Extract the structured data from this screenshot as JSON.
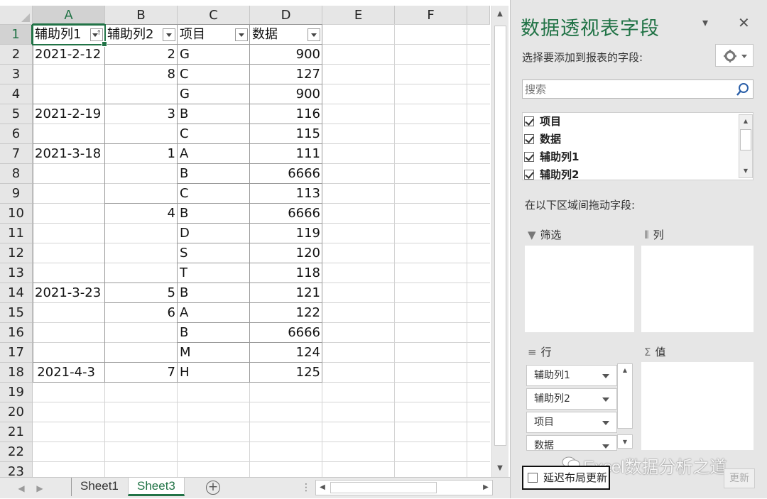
{
  "sheet": {
    "columns": [
      "A",
      "B",
      "C",
      "D",
      "E",
      "F"
    ],
    "rows": [
      "1",
      "2",
      "3",
      "4",
      "5",
      "6",
      "7",
      "8",
      "9",
      "10",
      "11",
      "12",
      "13",
      "14",
      "15",
      "16",
      "17",
      "18",
      "19",
      "20",
      "21",
      "22",
      "23"
    ],
    "headers": [
      "辅助列1",
      "辅助列2",
      "项目",
      "数据"
    ],
    "data": [
      [
        "2021-2-12",
        "2",
        "G",
        "900"
      ],
      [
        "",
        "8",
        "C",
        "127"
      ],
      [
        "",
        "",
        "G",
        "900"
      ],
      [
        "2021-2-19",
        "3",
        "B",
        "116"
      ],
      [
        "",
        "",
        "C",
        "115"
      ],
      [
        "2021-3-18",
        "1",
        "A",
        "111"
      ],
      [
        "",
        "",
        "B",
        "6666"
      ],
      [
        "",
        "",
        "C",
        "113"
      ],
      [
        "",
        "4",
        "B",
        "6666"
      ],
      [
        "",
        "",
        "D",
        "119"
      ],
      [
        "",
        "",
        "S",
        "120"
      ],
      [
        "",
        "",
        "T",
        "118"
      ],
      [
        "2021-3-23",
        "5",
        "B",
        "121"
      ],
      [
        "",
        "6",
        "A",
        "122"
      ],
      [
        "",
        "",
        "B",
        "6666"
      ],
      [
        "",
        "",
        "M",
        "124"
      ],
      [
        "2021-4-3",
        "7",
        "H",
        "125"
      ]
    ],
    "tabs": [
      "Sheet1",
      "Sheet3"
    ],
    "active_tab": "Sheet3"
  },
  "pane": {
    "title": "数据透视表字段",
    "choose_label": "选择要添加到报表的字段:",
    "search_placeholder": "搜索",
    "fields": [
      "项目",
      "数据",
      "辅助列1",
      "辅助列2"
    ],
    "drag_label": "在以下区域间拖动字段:",
    "areas": {
      "filter": "筛选",
      "columns": "列",
      "rows": "行",
      "values": "值"
    },
    "row_fields": [
      "辅助列1",
      "辅助列2",
      "项目",
      "数据"
    ],
    "defer_label": "延迟布局更新",
    "update_label": "更新",
    "watermark": "Excel数据分析之道"
  },
  "colors": {
    "accent": "#217346",
    "pane_bg": "#e6e6e6"
  }
}
